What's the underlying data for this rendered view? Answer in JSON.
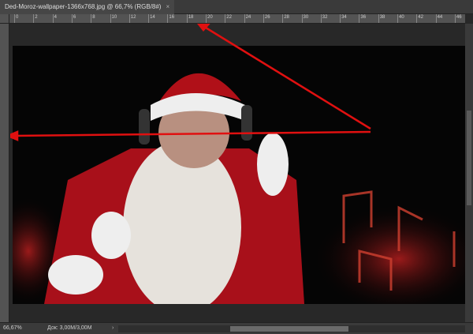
{
  "document": {
    "tab_title": "Ded-Moroz-wallpaper-1366x768.jpg @ 66,7% (RGB/8#)",
    "close": "×"
  },
  "ruler": {
    "ticks": [
      "0",
      "2",
      "4",
      "6",
      "8",
      "10",
      "12",
      "14",
      "16",
      "18",
      "20",
      "22",
      "24",
      "26",
      "28",
      "30",
      "32",
      "34",
      "36",
      "38",
      "40",
      "42",
      "44",
      "46"
    ]
  },
  "status": {
    "zoom": "66,67%",
    "doc": "Док: 3,00M/3,00M",
    "arrow": "›"
  },
  "colors": {
    "arrow": "#e01010"
  }
}
